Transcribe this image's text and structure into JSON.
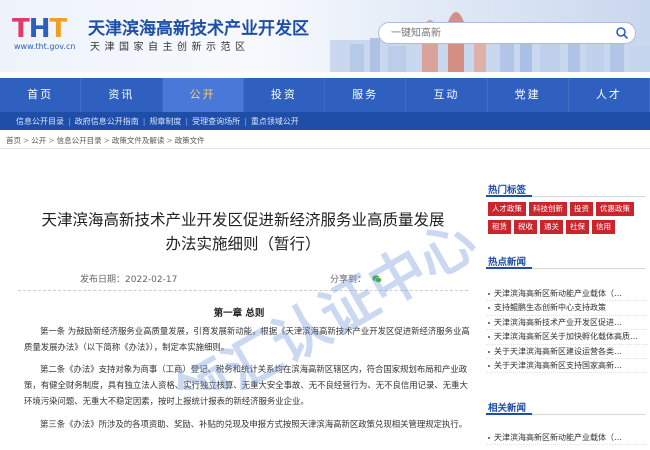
{
  "header": {
    "logo_letters": [
      "T",
      "H",
      "T"
    ],
    "url": "www.tht.gov.cn",
    "title": "天津滨海高新技术产业开发区",
    "subtitle": "天津国家自主创新示范区",
    "search_placeholder": "一键知高新",
    "icons": {
      "search": "search-icon"
    }
  },
  "colors": {
    "nav_bg": "#2f5fbf",
    "nav_active_bg": "#4a78d8",
    "nav_active_text": "#ffd54a",
    "subnav_bg": "#1f4ea8",
    "tag_red": "#c9252c",
    "side_head": "#1f4ea8"
  },
  "nav": {
    "items": [
      "首页",
      "资讯",
      "公开",
      "投资",
      "服务",
      "互动",
      "党建",
      "人才"
    ],
    "active_index": 2
  },
  "subnav": {
    "items": [
      "信息公开目录",
      "政府信息公开指南",
      "规章制度",
      "受理查询场所",
      "重点领域公开"
    ]
  },
  "breadcrumb": {
    "items": [
      "首页",
      "公开",
      "信息公开目录",
      "政策文件及解读",
      "政策文件"
    ]
  },
  "article": {
    "title_line1": "天津滨海高新技术产业开发区促进新经济服务业高质量发展",
    "title_line2": "办法实施细则（暂行）",
    "date_label": "发布日期：",
    "date": "2022-02-17",
    "share_label": "分享到：",
    "share_icon": "wechat-icon",
    "chapter": "第一章 总则",
    "paragraphs": [
      "第一条 为鼓励新经济服务业高质量发展，引育发展新动能，根据《天津滨海高新技术产业开发区促进新经济服务业高质量发展办法》（以下简称《办法》），制定本实施细则。",
      "第二条《办法》支持对象为商事（工商）登记、税务和统计关系均在滨海高新区辖区内，符合国家规划布局和产业政策，有健全财务制度，具有独立法人资格、实行独立核算、无重大安全事故、无不良经营行为、无不良信用记录、无重大环境污染问题、无重大不稳定因素，按时上报统计报表的新经济服务业企业。",
      "第三条《办法》所涉及的各项资助、奖励、补贴的兑现及申报方式按照天津滨海高新区政策兑现相关管理规定执行。"
    ],
    "watermark": "领汇认证中心"
  },
  "sidebar": {
    "tags_head": "热门标签",
    "tags": [
      "人才政策",
      "科技创新",
      "投资",
      "优惠政策",
      "租赁",
      "税收",
      "通关",
      "社保",
      "信用"
    ],
    "hot_head": "热点新闻",
    "hot_items": [
      "天津滨海高新区新动能产业载体（…",
      "支持鲲鹏生态创新中心支持政策",
      "天津滨海高新技术产业开发区促进…",
      "天津滨海高新区关于加快孵化载体高质…",
      "关于天津滨海高新区建设运营各类…",
      "关于天津滨海高新区支持国家高新…"
    ],
    "related_head": "相关新闻",
    "related_items": [
      "天津滨海高新区新动能产业载体（…"
    ]
  }
}
